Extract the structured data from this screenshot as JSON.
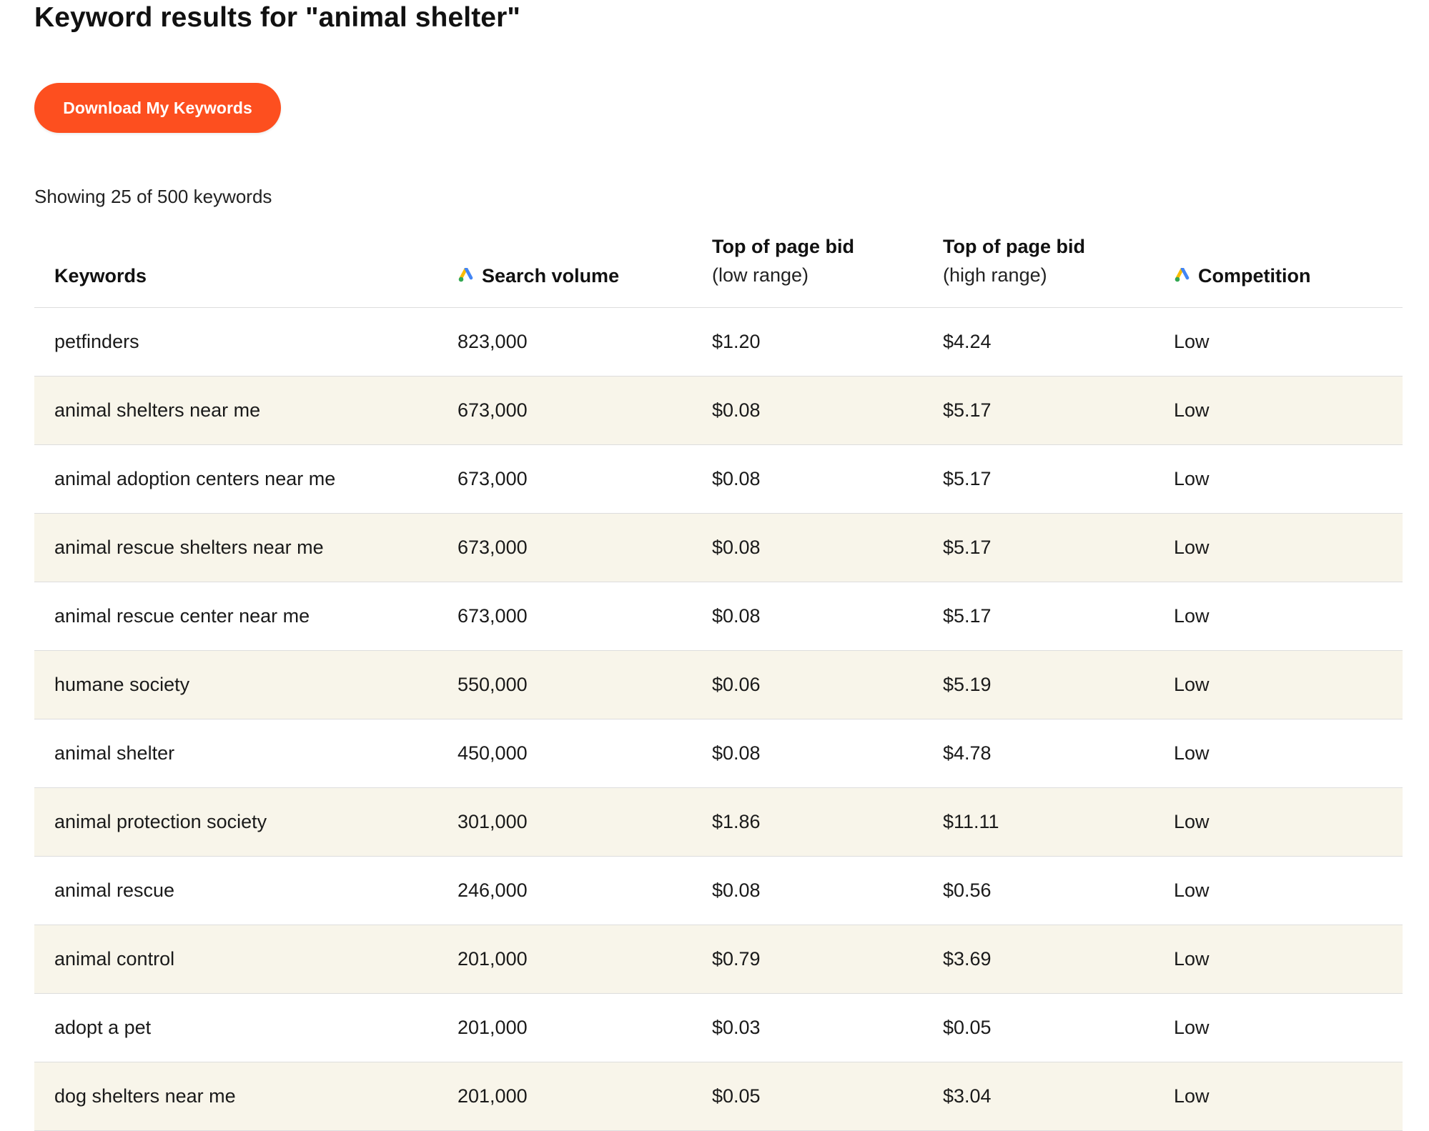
{
  "header": {
    "title": "Keyword results for \"animal shelter\""
  },
  "actions": {
    "download_label": "Download My Keywords"
  },
  "summary": {
    "showing_text": "Showing 25 of 500 keywords"
  },
  "table": {
    "columns": {
      "keywords": "Keywords",
      "search_volume": "Search volume",
      "bid_low_title": "Top of page bid",
      "bid_low_sub": "(low range)",
      "bid_high_title": "Top of page bid",
      "bid_high_sub": "(high range)",
      "competition": "Competition"
    },
    "icons": {
      "header_icon": "google-ads-icon",
      "colors": [
        "#fbbc04",
        "#4285f4",
        "#34a853"
      ]
    },
    "rows": [
      {
        "keyword": "petfinders",
        "volume": "823,000",
        "low": "$1.20",
        "high": "$4.24",
        "competition": "Low"
      },
      {
        "keyword": "animal shelters near me",
        "volume": "673,000",
        "low": "$0.08",
        "high": "$5.17",
        "competition": "Low"
      },
      {
        "keyword": "animal adoption centers near me",
        "volume": "673,000",
        "low": "$0.08",
        "high": "$5.17",
        "competition": "Low"
      },
      {
        "keyword": "animal rescue shelters near me",
        "volume": "673,000",
        "low": "$0.08",
        "high": "$5.17",
        "competition": "Low"
      },
      {
        "keyword": "animal rescue center near me",
        "volume": "673,000",
        "low": "$0.08",
        "high": "$5.17",
        "competition": "Low"
      },
      {
        "keyword": "humane society",
        "volume": "550,000",
        "low": "$0.06",
        "high": "$5.19",
        "competition": "Low"
      },
      {
        "keyword": "animal shelter",
        "volume": "450,000",
        "low": "$0.08",
        "high": "$4.78",
        "competition": "Low"
      },
      {
        "keyword": "animal protection society",
        "volume": "301,000",
        "low": "$1.86",
        "high": "$11.11",
        "competition": "Low"
      },
      {
        "keyword": "animal rescue",
        "volume": "246,000",
        "low": "$0.08",
        "high": "$0.56",
        "competition": "Low"
      },
      {
        "keyword": "animal control",
        "volume": "201,000",
        "low": "$0.79",
        "high": "$3.69",
        "competition": "Low"
      },
      {
        "keyword": "adopt a pet",
        "volume": "201,000",
        "low": "$0.03",
        "high": "$0.05",
        "competition": "Low"
      },
      {
        "keyword": "dog shelters near me",
        "volume": "201,000",
        "low": "$0.05",
        "high": "$3.04",
        "competition": "Low"
      }
    ]
  }
}
